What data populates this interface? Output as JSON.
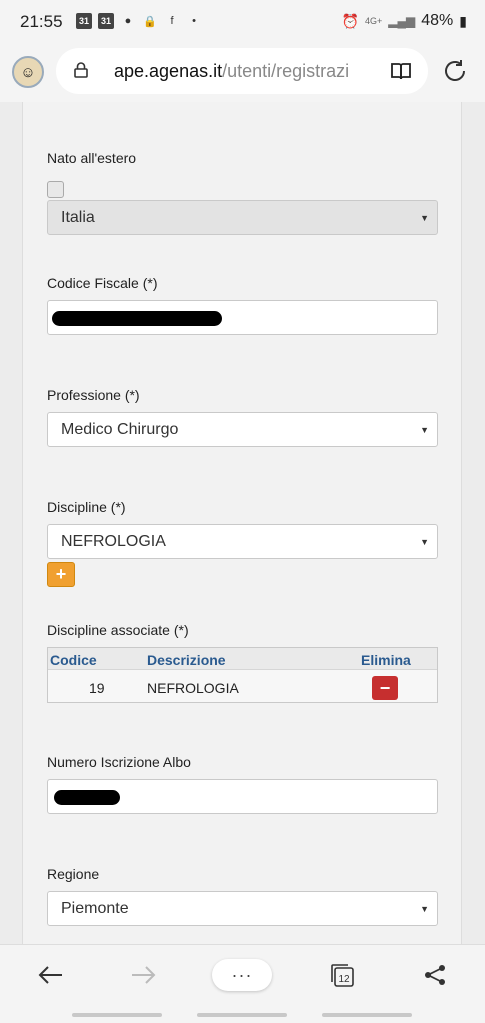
{
  "status_bar": {
    "time": "21:55",
    "left_icons": [
      "calendar-icon",
      "calendar-icon",
      "chat-icon",
      "lock-icon",
      "facebook-icon",
      "dot-icon"
    ],
    "network": "4G+",
    "battery": "48%"
  },
  "browser": {
    "url_host": "ape.agenas.it",
    "url_path": "/utenti/registrazi",
    "tab_count": "12"
  },
  "form": {
    "nato_estero_label": "Nato all'estero",
    "nazione_value": "Italia",
    "codice_fiscale_label": "Codice Fiscale (*)",
    "professione_label": "Professione (*)",
    "professione_value": "Medico Chirurgo",
    "discipline_label": "Discipline (*)",
    "discipline_value": "NEFROLOGIA",
    "add_button_label": "+",
    "discipline_associate_label": "Discipline associate (*)",
    "table": {
      "headers": [
        "Codice",
        "Descrizione",
        "Elimina"
      ],
      "rows": [
        {
          "codice": "19",
          "descrizione": "NEFROLOGIA",
          "elimina_label": "−"
        }
      ]
    },
    "numero_albo_label": "Numero Iscrizione Albo",
    "regione_label": "Regione",
    "regione_value": "Piemonte"
  },
  "bottom_nav": {
    "menu_label": "···"
  },
  "colors": {
    "add_button": "#f0a030",
    "delete_button": "#c62f2f",
    "table_header_text": "#2a5a8f"
  }
}
